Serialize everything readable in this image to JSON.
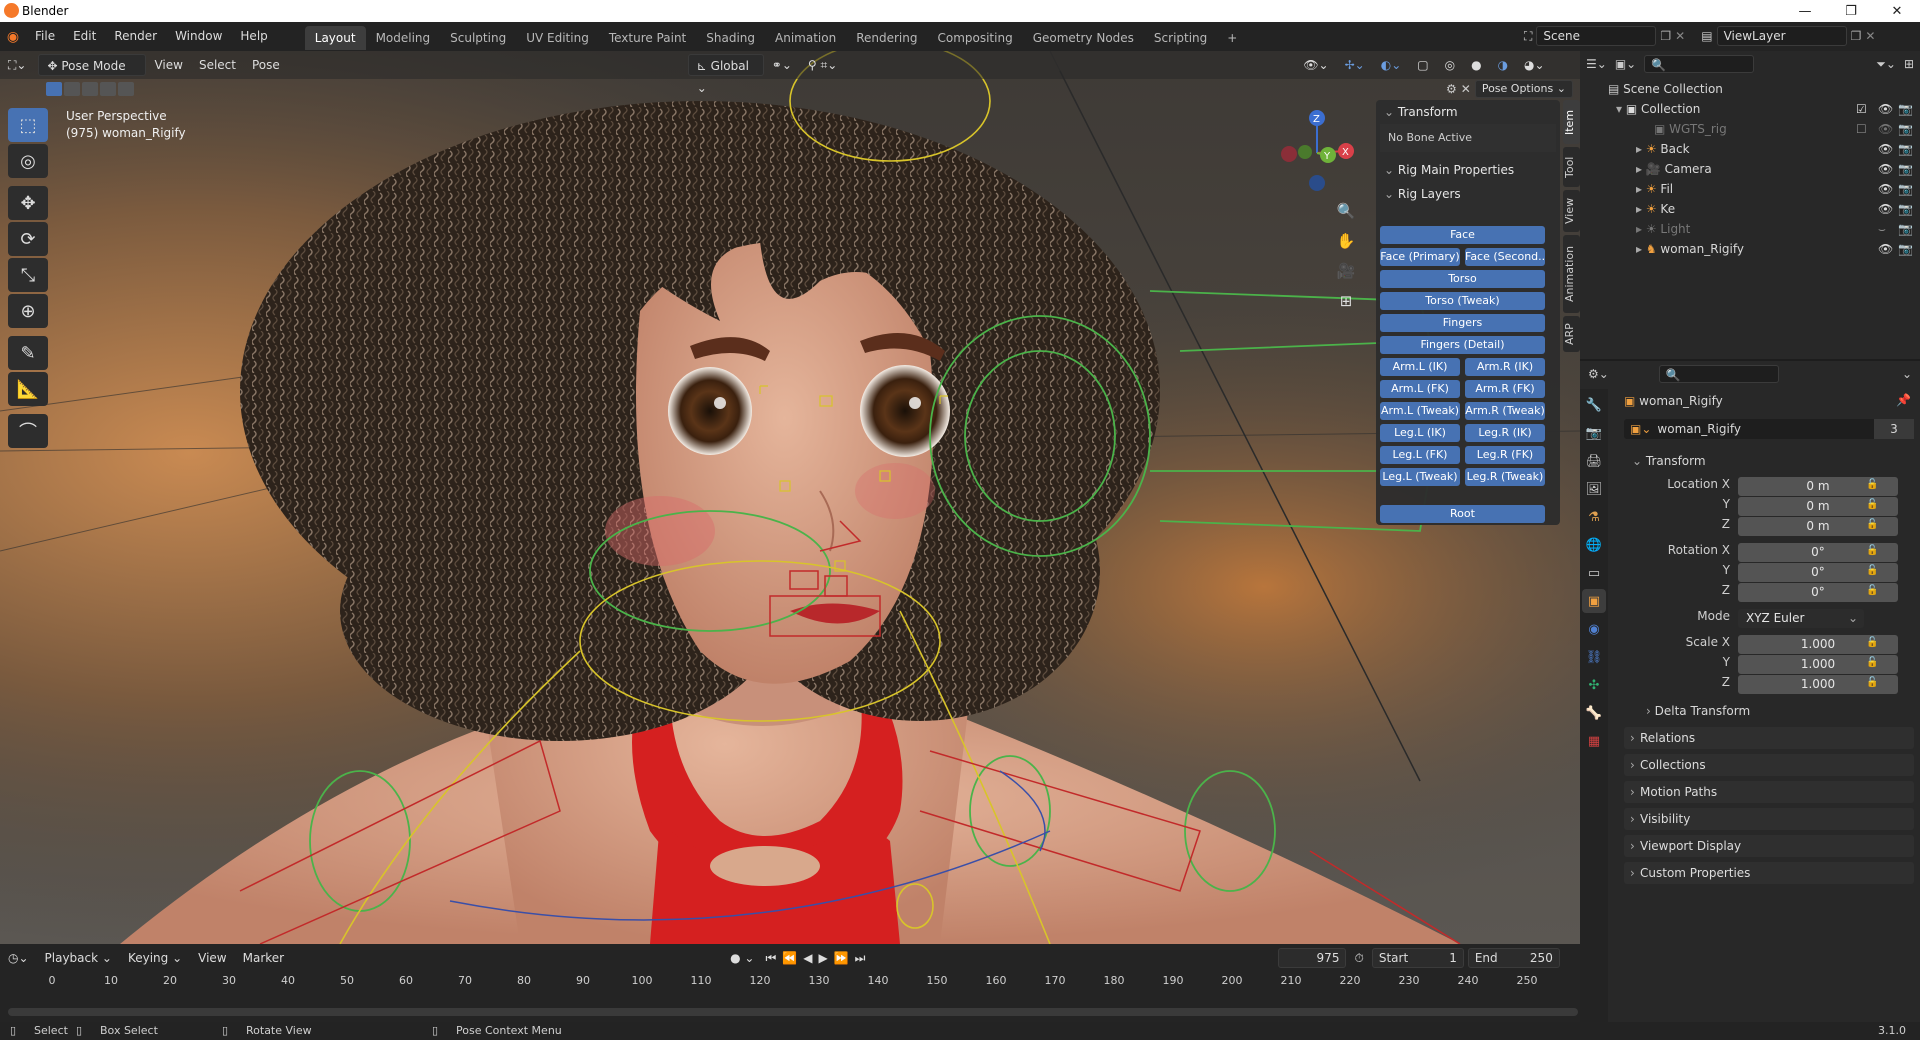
{
  "app": {
    "title": "Blender",
    "version": "3.1.0"
  },
  "menu": {
    "items": [
      "File",
      "Edit",
      "Render",
      "Window",
      "Help"
    ]
  },
  "workspaces": [
    "Layout",
    "Modeling",
    "Sculpting",
    "UV Editing",
    "Texture Paint",
    "Shading",
    "Animation",
    "Rendering",
    "Compositing",
    "Geometry Nodes",
    "Scripting"
  ],
  "scene": {
    "scene_name": "Scene",
    "view_layer": "ViewLayer"
  },
  "viewport": {
    "mode": "Pose Mode",
    "menus": [
      "View",
      "Select",
      "Pose"
    ],
    "transform_orientation": "Global",
    "perspective_label": "User Perspective",
    "object_label": "(975) woman_Rigify",
    "pose_options": "Pose Options",
    "gizmo_axes": {
      "z": "Z",
      "y": "Y",
      "x": "X"
    }
  },
  "npanel": {
    "transform_header": "Transform",
    "no_bone": "No Bone Active",
    "rig_main": "Rig Main Properties",
    "rig_layers": "Rig Layers",
    "layers": {
      "face": "Face",
      "face_primary": "Face (Primary)",
      "face_secondary": "Face (Second...",
      "torso": "Torso",
      "torso_tweak": "Torso (Tweak)",
      "fingers": "Fingers",
      "fingers_detail": "Fingers (Detail)",
      "arm_l_ik": "Arm.L (IK)",
      "arm_r_ik": "Arm.R (IK)",
      "arm_l_fk": "Arm.L (FK)",
      "arm_r_fk": "Arm.R (FK)",
      "arm_l_tweak": "Arm.L (Tweak)",
      "arm_r_tweak": "Arm.R (Tweak)",
      "leg_l_ik": "Leg.L (IK)",
      "leg_r_ik": "Leg.R (IK)",
      "leg_l_fk": "Leg.L (FK)",
      "leg_r_fk": "Leg.R (FK)",
      "leg_l_tweak": "Leg.L (Tweak)",
      "leg_r_tweak": "Leg.R (Tweak)",
      "root": "Root"
    },
    "tabs": [
      "Item",
      "Tool",
      "View",
      "Animation",
      "ARP"
    ]
  },
  "outliner": {
    "scene_collection": "Scene Collection",
    "collection": "Collection",
    "items": [
      {
        "name": "WGTS_rig"
      },
      {
        "name": "Back"
      },
      {
        "name": "Camera"
      },
      {
        "name": "Fil"
      },
      {
        "name": "Ke"
      },
      {
        "name": "Light"
      },
      {
        "name": "woman_Rigify"
      }
    ]
  },
  "properties": {
    "object_name": "woman_Rigify",
    "data_name": "woman_Rigify",
    "users": "3",
    "transform": "Transform",
    "location_label": "Location X",
    "rotation_label": "Rotation X",
    "scale_label": "Scale X",
    "y": "Y",
    "z": "Z",
    "loc_x": "0 m",
    "loc_y": "0 m",
    "loc_z": "0 m",
    "rot_x": "0°",
    "rot_y": "0°",
    "rot_z": "0°",
    "mode_label": "Mode",
    "mode_value": "XYZ Euler",
    "scale_x": "1.000",
    "scale_y": "1.000",
    "scale_z": "1.000",
    "delta": "Delta Transform",
    "sections": [
      "Relations",
      "Collections",
      "Motion Paths",
      "Visibility",
      "Viewport Display",
      "Custom Properties"
    ]
  },
  "timeline": {
    "menus": [
      "Playback",
      "Keying",
      "View",
      "Marker"
    ],
    "current_frame": "975",
    "start_label": "Start",
    "start": "1",
    "end_label": "End",
    "end": "250",
    "ticks": [
      "0",
      "10",
      "20",
      "30",
      "40",
      "50",
      "60",
      "70",
      "80",
      "90",
      "100",
      "110",
      "120",
      "130",
      "140",
      "150",
      "160",
      "170",
      "180",
      "190",
      "200",
      "210",
      "220",
      "230",
      "240",
      "250"
    ]
  },
  "status": {
    "select": "Select",
    "box_select": "Box Select",
    "rotate_view": "Rotate View",
    "pose_context_menu": "Pose Context Menu"
  },
  "colors": {
    "accent": "#4772b3",
    "skin": "#d9a68c",
    "hair": "#2e241d",
    "bone_green": "#4bb34a",
    "bone_red": "#c22a2a",
    "bone_yellow": "#d8c42a"
  }
}
